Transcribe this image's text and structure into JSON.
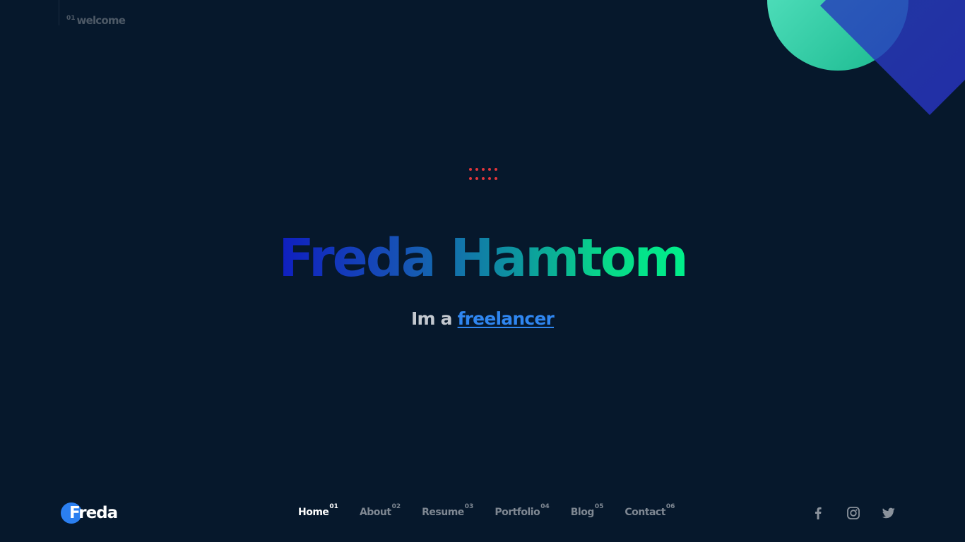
{
  "section": {
    "number": "01",
    "label": "welcome"
  },
  "hero": {
    "name": "Freda Hamtom",
    "subtitle_prefix": "Im a",
    "subtitle_role": "freelancer"
  },
  "logo": {
    "text": "Freda"
  },
  "nav": {
    "items": [
      {
        "label": "Home",
        "number": "01",
        "active": true
      },
      {
        "label": "About",
        "number": "02"
      },
      {
        "label": "Resume",
        "number": "03"
      },
      {
        "label": "Portfolio",
        "number": "04"
      },
      {
        "label": "Blog",
        "number": "05"
      },
      {
        "label": "Contact",
        "number": "06"
      }
    ]
  },
  "social": {
    "icons": [
      "facebook-icon",
      "instagram-icon",
      "twitter-icon"
    ]
  },
  "colors": {
    "background": "#06182c",
    "accent_blue": "#2b7ff0",
    "accent_green": "#00f08a",
    "dots_red": "#e2363b",
    "nav_inactive": "#7e8792",
    "nav_active": "#ffffff"
  }
}
